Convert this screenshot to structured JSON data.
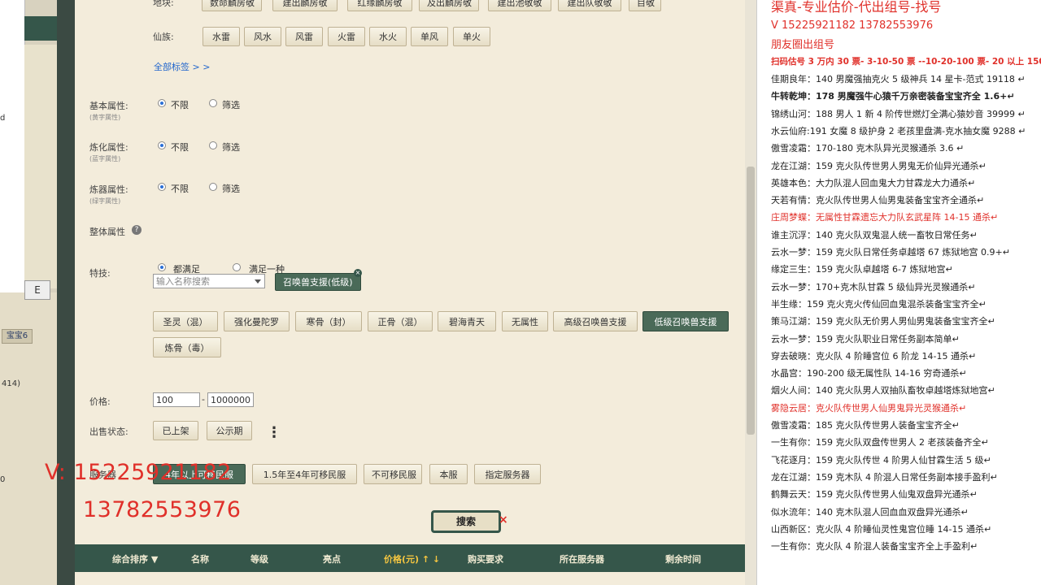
{
  "left_app": {
    "tab_label": "宝宝6",
    "number_text": "414)",
    "partial_letter": "E",
    "side_text_a": "d",
    "side_text_b": "0"
  },
  "filters": {
    "top_partial_label": "地块:",
    "top_row": [
      "数命麟房敬",
      "建出麟房敬",
      "红缘麟房敬",
      "及出麟房敬",
      "建出池敬敬",
      "建出队敬敬",
      "目敬"
    ],
    "xianzu_label": "仙族:",
    "xianzu_buttons": [
      "水雷",
      "风水",
      "风雷",
      "火雷",
      "水火",
      "单风",
      "单火"
    ],
    "all_tags_link": "全部标签 > >",
    "basic_attr": {
      "label": "基本属性:",
      "sub": "(黄字属性)"
    },
    "refine_attr": {
      "label": "炼化属性:",
      "sub": "(蓝字属性)"
    },
    "forge_attr": {
      "label": "炼器属性:",
      "sub": "(绿字属性)"
    },
    "radio_unlimited": "不限",
    "radio_filter": "筛选",
    "overall_attr": "整体属性",
    "help_icon_text": "?",
    "skill_label": "特技:",
    "skill_radio_all": "都满足",
    "skill_radio_one": "满足一种",
    "skill_search_placeholder": "输入名称搜索",
    "skill_selected_tag": "召唤兽支援(低级)",
    "skill_buttons_row1": [
      "圣灵（混）",
      "强化曼陀罗",
      "寒骨（封）",
      "正骨（混）",
      "碧海青天",
      "无属性",
      "高级召唤兽支援",
      "低级召唤兽支援"
    ],
    "skill_buttons_row2": [
      "炼骨（毒）"
    ],
    "price_label": "价格:",
    "price_min": "100",
    "price_sep": "-",
    "price_max": "1000000",
    "sale_status_label": "出售状态:",
    "sale_status_buttons": [
      "已上架",
      "公示期"
    ],
    "more_icon": "⋮",
    "server_label": "服务器",
    "server_buttons": [
      "4年以上可移民服",
      "1.5年至4年可移民服",
      "不可移民服",
      "本服",
      "指定服务器"
    ],
    "search_button": "搜索",
    "close_mark": "×"
  },
  "table_header": [
    "综合排序 ▼",
    "名称",
    "等级",
    "亮点",
    "价格(元) ↑ ↓",
    "购买要求",
    "所在服务器",
    "剩余时间"
  ],
  "watermark": {
    "line1": "V:  15225921182",
    "line2": "13782553976"
  },
  "right_panel": {
    "title": "渠真-专业估价-代出组号-找号",
    "contact": "V   15225921182   13782553976",
    "note": "朋友圈出组号",
    "promo": "扫码估号 3 万内 30 票- 3-10-50 票 --10-20-100 票- 20 以上 150",
    "lines": [
      {
        "text": "佳期良年：140 男魔强抽克火 5 级神兵 14 星卡-范式 19118 ↵",
        "style": "normal"
      },
      {
        "text": "牛转乾坤：178 男魔强牛心猿千万亲密装备宝宝齐全 1.6+↵",
        "style": "bold"
      },
      {
        "text": "锦绣山河：188 男人 1 新 4 阶传世燃灯全满心猿妙音 39999 ↵",
        "style": "normal"
      },
      {
        "text": "水云仙府:191 女魔 8 级护身 2 老孩里盘满-克水抽女魔 9288 ↵",
        "style": "normal"
      },
      {
        "text": "傲雪凌霜：170-180 克木队异光灵猴通杀 3.6 ↵",
        "style": "normal"
      },
      {
        "text": "龙在江湖：159 克火队传世男人男鬼无价仙异光通杀↵",
        "style": "normal"
      },
      {
        "text": "英雄本色：大力队混人回血鬼大力甘霖龙大力通杀↵",
        "style": "normal"
      },
      {
        "text": "天若有情：克火队传世男人仙男鬼装备宝宝齐全通杀↵",
        "style": "normal"
      },
      {
        "text": "庄周梦蝶：无属性甘霖遗忘大力队玄武星阵 14-15 通杀↵",
        "style": "red"
      },
      {
        "text": "谁主沉浮：140 克火队双鬼混人统一畜牧日常任务↵",
        "style": "normal"
      },
      {
        "text": "云水一梦：159 克火队日常任务卓越塔 67 炼狱地宫 0.9+↵",
        "style": "normal"
      },
      {
        "text": "缘定三生：159 克火队卓越塔 6-7 炼狱地宫↵",
        "style": "normal"
      },
      {
        "text": "云水一梦：170+克木队甘霖 5 级仙异光灵猴通杀↵",
        "style": "normal"
      },
      {
        "text": "半生缘：159 克火克火传仙回血鬼混杀装备宝宝齐全↵",
        "style": "normal"
      },
      {
        "text": "策马江湖：159 克火队无价男人男仙男鬼装备宝宝齐全↵",
        "style": "normal"
      },
      {
        "text": "云水一梦：159 克火队职业日常任务副本简单↵",
        "style": "normal"
      },
      {
        "text": "穿去破晓：克火队 4 阶睡宫位 6 阶龙 14-15 通杀↵",
        "style": "normal"
      },
      {
        "text": "水晶宫：190-200 级无属性队 14-16 穷奇通杀↵",
        "style": "normal"
      },
      {
        "text": "烟火人间：140 克火队男人双抽队畜牧卓越塔炼狱地宫↵",
        "style": "normal"
      },
      {
        "text": "雾隐云居：克火队传世男人仙男鬼异光灵猴通杀↵",
        "style": "red"
      },
      {
        "text": "傲雪凌霜：185 克火队传世男人装备宝宝齐全↵",
        "style": "normal"
      },
      {
        "text": "一生有你：159 克火队双盘传世男人 2 老孩装备齐全↵",
        "style": "normal"
      },
      {
        "text": "飞花逐月：159 克火队传世 4 阶男人仙甘霖生活 5 级↵",
        "style": "normal"
      },
      {
        "text": "龙在江湖：159 克木队 4 阶混人日常任务副本接手盈利↵",
        "style": "normal"
      },
      {
        "text": "鹤舞云天：159 克火队传世男人仙鬼双盘异光通杀↵",
        "style": "normal"
      },
      {
        "text": "似水流年：140 克木队混人回血血双盘异光通杀↵",
        "style": "normal"
      },
      {
        "text": "山西新区：克火队 4 阶睡仙灵性鬼宫位睡 14-15 通杀↵",
        "style": "normal"
      },
      {
        "text": "一生有你：克火队 4 阶混人装备宝宝齐全上手盈利↵",
        "style": "normal"
      }
    ]
  }
}
